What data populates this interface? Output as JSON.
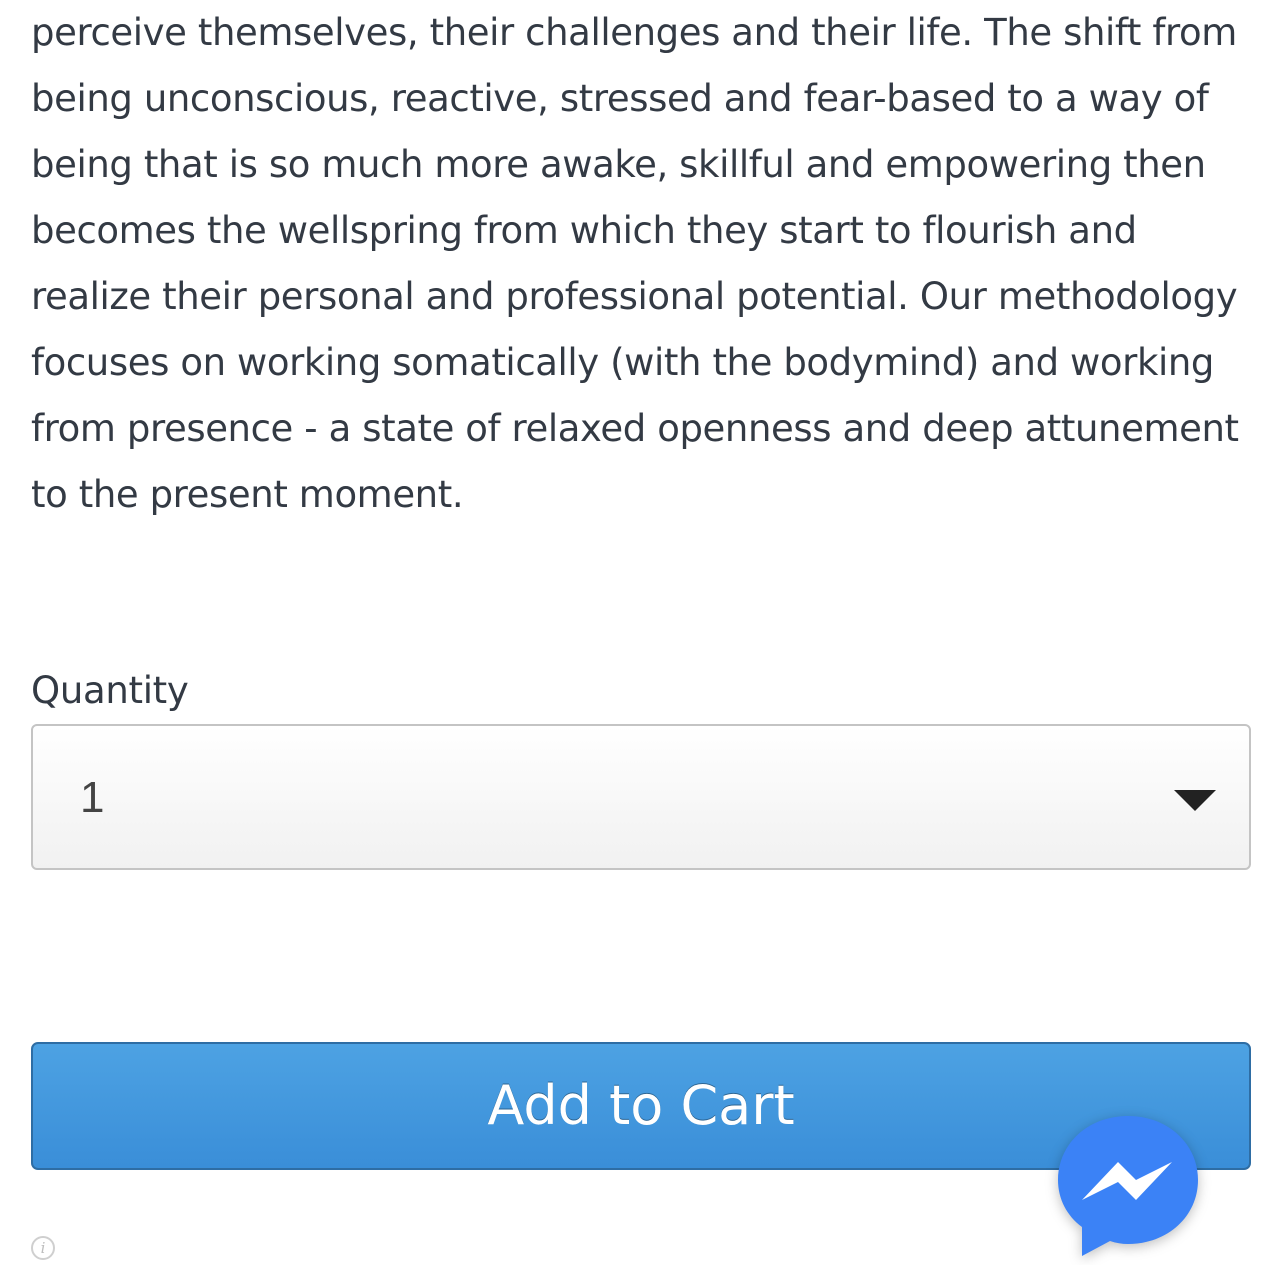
{
  "description": {
    "lines": [
      "perceive themselves, their challenges and their life. The shift from",
      "being unconscious, reactive, stressed and fear-based to a way of",
      "being that is so much more awake, skillful and empowering then",
      "becomes the wellspring from which they start to flourish and",
      "realize their personal and professional potential. Our methodology",
      "focuses on working somatically (with the bodymind) and working",
      "from presence -  a state of relaxed openness and deep attunement",
      "to the present moment."
    ]
  },
  "quantity": {
    "label": "Quantity",
    "selected": "1"
  },
  "cart": {
    "add_label": "Add to Cart",
    "accent_color": "#3a8ed8"
  },
  "icons": {
    "info": "info-icon",
    "messenger": "messenger-icon"
  }
}
